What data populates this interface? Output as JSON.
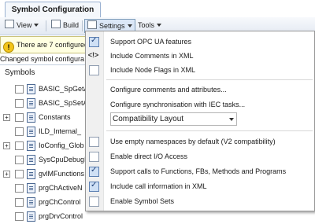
{
  "tab": {
    "title": "Symbol Configuration"
  },
  "toolbar": {
    "view_label": "View",
    "build_label": "Build",
    "settings_label": "Settings",
    "tools_label": "Tools"
  },
  "info": {
    "message": "There are 7 configured"
  },
  "changed": {
    "text": "Changed symbol configura"
  },
  "tree": {
    "header": "Symbols",
    "items": [
      {
        "label": "BASIC_SpGetA",
        "expandable": false
      },
      {
        "label": "BASIC_SpSetA",
        "expandable": false
      },
      {
        "label": "Constants",
        "expandable": true
      },
      {
        "label": "ILD_Internal_",
        "expandable": false
      },
      {
        "label": "IoConfig_Glob",
        "expandable": true
      },
      {
        "label": "SysCpuDebugI",
        "expandable": false
      },
      {
        "label": "gvlMFunctions",
        "expandable": true
      },
      {
        "label": "prgChActiveN",
        "expandable": false
      },
      {
        "label": "prgChControl",
        "expandable": false
      },
      {
        "label": "prgDrvControl",
        "expandable": false
      }
    ]
  },
  "menu": {
    "items": [
      {
        "label": "Support OPC UA features",
        "checked": true
      },
      {
        "label": "Include Comments in XML",
        "checked": false,
        "icon": "xml-icon"
      },
      {
        "label": "Include Node Flags in XML",
        "checked": false
      },
      {
        "label": "Configure comments and attributes...",
        "checked": false
      },
      {
        "label": "Configure synchronisation with IEC tasks...",
        "checked": false
      },
      {
        "label": "Use empty namespaces by default (V2 compatibility)",
        "checked": false
      },
      {
        "label": "Enable direct I/O Access",
        "checked": false
      },
      {
        "label": "Support calls to Functions, FBs, Methods and Programs",
        "checked": true
      },
      {
        "label": "Include call information in XML",
        "checked": true
      },
      {
        "label": "Enable Symbol Sets",
        "checked": false
      }
    ],
    "layout_combo": {
      "value": "Compatibility Layout"
    }
  }
}
